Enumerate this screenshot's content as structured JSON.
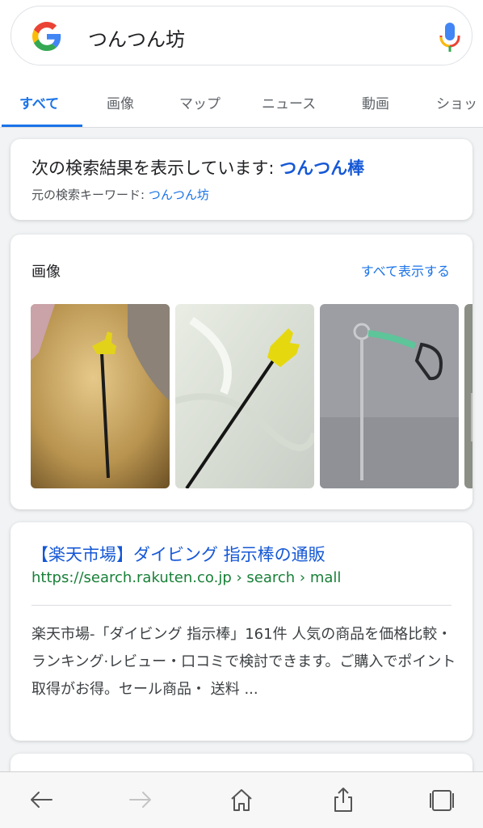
{
  "search": {
    "query": "つんつん坊"
  },
  "tabs": [
    {
      "label": "すべて",
      "active": true
    },
    {
      "label": "画像"
    },
    {
      "label": "マップ"
    },
    {
      "label": "ニュース"
    },
    {
      "label": "動画"
    },
    {
      "label": "ショッ"
    }
  ],
  "correction": {
    "prefix": "次の検索結果を表示しています: ",
    "corrected_query": "つんつん棒",
    "original_prefix": "元の検索キーワード: ",
    "original_query": "つんつん坊"
  },
  "images_section": {
    "title": "画像",
    "view_all": "すべて表示する"
  },
  "result": {
    "title": "【楽天市場】ダイビング 指示棒の通販",
    "url": "https://search.rakuten.co.jp › search › mall",
    "snippet": "楽天市場-「ダイビング 指示棒」161件 人気の商品を価格比較・ランキング·レビュー・口コミで検討できます。ご購入でポイント取得がお得。セール商品・ 送料 ..."
  },
  "icons": {
    "back": "back-arrow-icon",
    "forward": "forward-arrow-icon",
    "home": "home-icon",
    "share": "share-icon",
    "tabs": "tabs-icon"
  },
  "colors": {
    "accent": "#1a73e8",
    "url_green": "#188038"
  }
}
